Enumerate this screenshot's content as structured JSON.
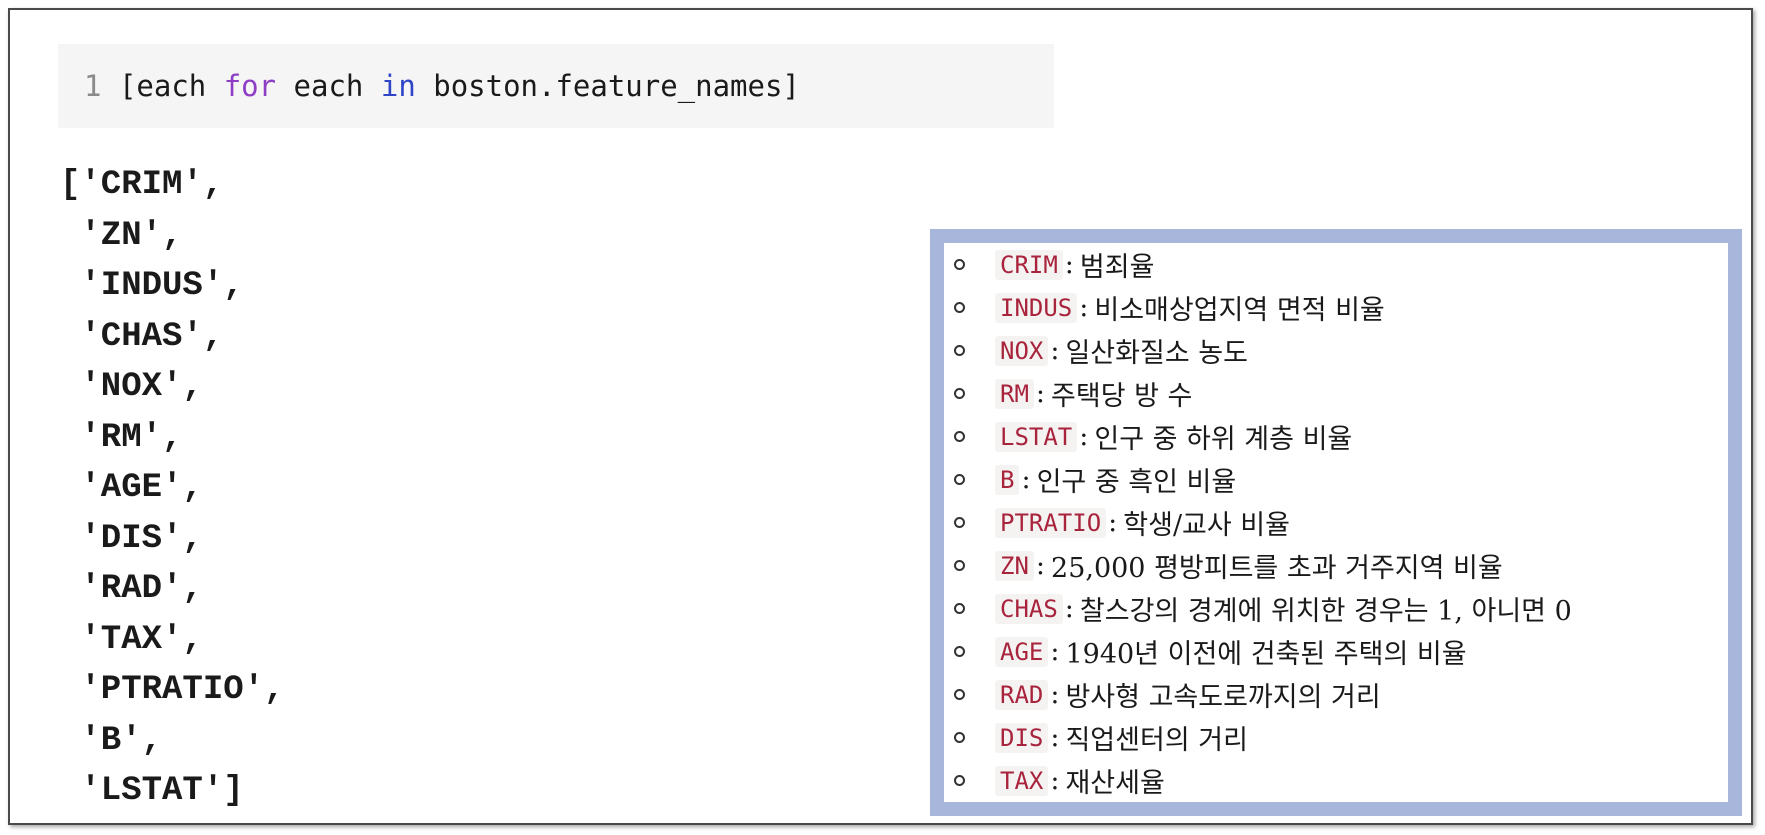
{
  "code_cell": {
    "line_number": "1",
    "tokens": [
      "[each ",
      "for",
      " each ",
      "in",
      " boston.feature_names]"
    ]
  },
  "output_lines": [
    "['CRIM',",
    " 'ZN',",
    " 'INDUS',",
    " 'CHAS',",
    " 'NOX',",
    " 'RM',",
    " 'AGE',",
    " 'DIS',",
    " 'RAD',",
    " 'TAX',",
    " 'PTRATIO',",
    " 'B',",
    " 'LSTAT']"
  ],
  "legend": {
    "separator": ":",
    "items": [
      {
        "term": "CRIM",
        "desc": "범죄율"
      },
      {
        "term": "INDUS",
        "desc": "비소매상업지역 면적 비율"
      },
      {
        "term": "NOX",
        "desc": "일산화질소 농도"
      },
      {
        "term": "RM",
        "desc": "주택당 방 수"
      },
      {
        "term": "LSTAT",
        "desc": "인구 중 하위 계층 비율"
      },
      {
        "term": "B",
        "desc": "인구 중 흑인 비율"
      },
      {
        "term": "PTRATIO",
        "desc": "학생/교사 비율"
      },
      {
        "term": "ZN",
        "desc": "25,000 평방피트를 초과 거주지역 비율"
      },
      {
        "term": "CHAS",
        "desc": "찰스강의 경계에 위치한 경우는 1, 아니면 0"
      },
      {
        "term": "AGE",
        "desc": "1940년 이전에 건축된 주택의 비율"
      },
      {
        "term": "RAD",
        "desc": "방사형 고속도로까지의 거리"
      },
      {
        "term": "DIS",
        "desc": "직업센터의 거리"
      },
      {
        "term": "TAX",
        "desc": "재산세율"
      }
    ]
  },
  "colors": {
    "keyword_for": "#8e3ec4",
    "keyword_in": "#2f45c7",
    "term_text": "#a8243c",
    "legend_border": "#a9b6dc"
  }
}
